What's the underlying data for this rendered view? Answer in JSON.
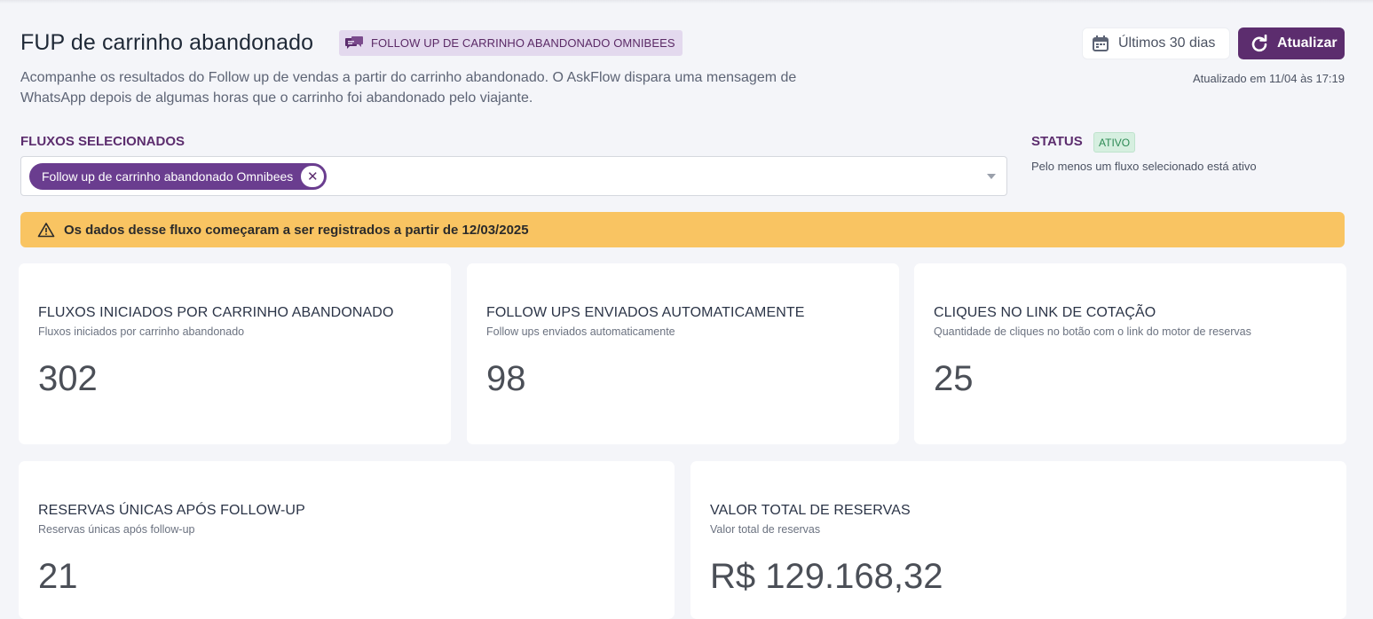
{
  "header": {
    "title": "FUP de carrinho abandonado",
    "badge": "FOLLOW UP DE CARRINHO ABANDONADO OMNIBEES",
    "subtitle": "Acompanhe os resultados do Follow up de vendas a partir do carrinho abandonado. O AskFlow dispara uma mensagem de WhatsApp depois de algumas horas que o carrinho foi abandonado pelo viajante.",
    "date_range_label": "Últimos 30 dias",
    "refresh_label": "Atualizar",
    "updated_text": "Atualizado em 11/04 às 17:19"
  },
  "flows": {
    "label": "FLUXOS SELECIONADOS",
    "selected": [
      "Follow up de carrinho abandonado Omnibees"
    ]
  },
  "status": {
    "label": "STATUS",
    "value": "ATIVO",
    "note": "Pelo menos um fluxo selecionado está ativo"
  },
  "alert": {
    "text": "Os dados desse fluxo começaram a ser registrados a partir de 12/03/2025"
  },
  "cards": [
    {
      "title": "FLUXOS INICIADOS POR CARRINHO ABANDONADO",
      "subtitle": "Fluxos iniciados por carrinho abandonado",
      "value": "302"
    },
    {
      "title": "FOLLOW UPS ENVIADOS AUTOMATICAMENTE",
      "subtitle": "Follow ups enviados automaticamente",
      "value": "98"
    },
    {
      "title": "CLIQUES NO LINK DE COTAÇÃO",
      "subtitle": "Quantidade de cliques no botão com o link do motor de reservas",
      "value": "25"
    },
    {
      "title": "RESERVAS ÚNICAS APÓS FOLLOW-UP",
      "subtitle": "Reservas únicas após follow-up",
      "value": "21"
    },
    {
      "title": "VALOR TOTAL DE RESERVAS",
      "subtitle": "Valor total de reservas",
      "value": "R$ 129.168,32"
    }
  ],
  "colors": {
    "brand": "#5c2d6e",
    "chip": "#6a3d8f",
    "alert": "#f9c462",
    "status_bg": "#d6efe0",
    "status_text": "#2d8a55"
  },
  "icons": {
    "badge": "chat-bubbles-icon",
    "date": "calendar-icon",
    "refresh": "refresh-icon",
    "alert": "warning-triangle-icon",
    "chip_remove": "close-icon",
    "dropdown": "caret-down-icon"
  }
}
